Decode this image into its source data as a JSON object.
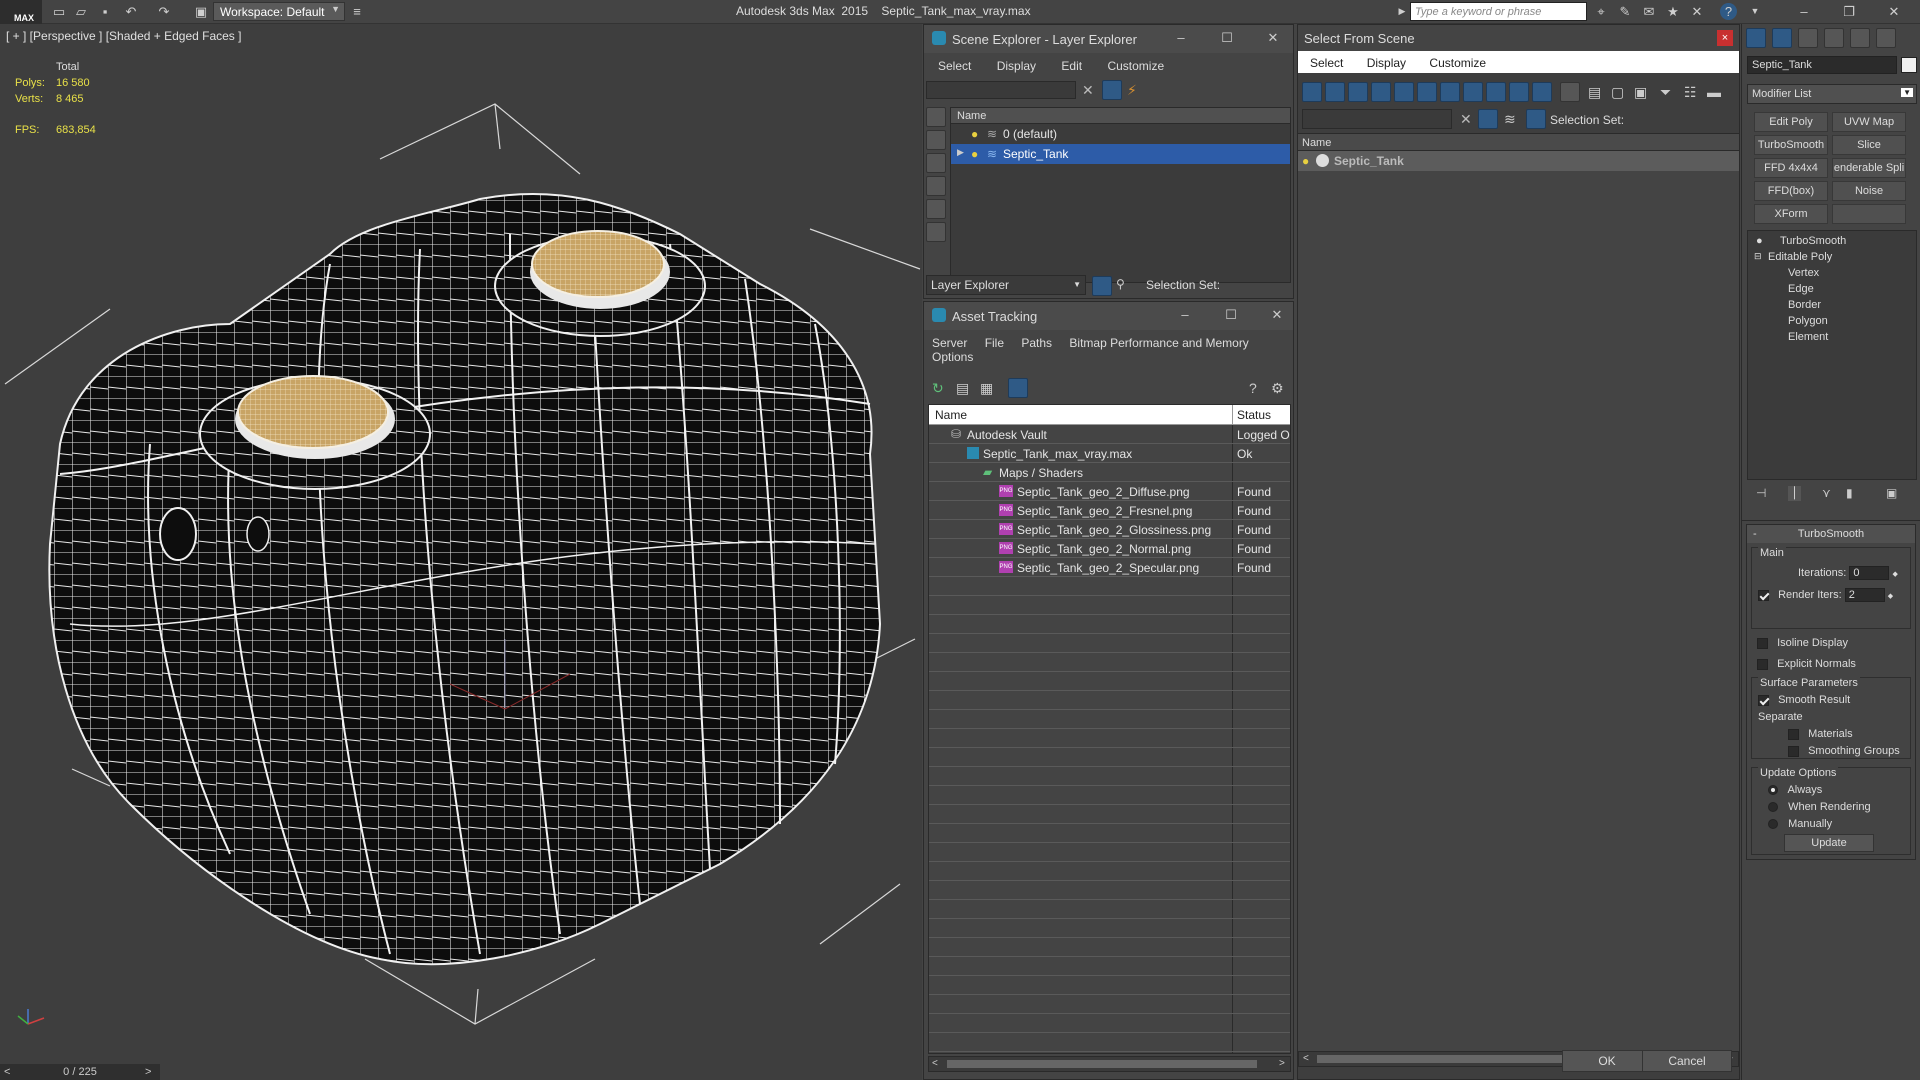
{
  "app": {
    "logo": "MAX",
    "workspace": "Workspace: Default",
    "title": "Autodesk 3ds Max  2015    Septic_Tank_max_vray.max",
    "search_placeholder": "Type a keyword or phrase"
  },
  "viewport": {
    "label": "[ + ] [Perspective ] [Shaded + Edged Faces ]",
    "stats": {
      "total_label": "Total",
      "polys_label": "Polys:",
      "polys": "16 580",
      "verts_label": "Verts:",
      "verts": "8 465",
      "fps_label": "FPS:",
      "fps": "683,854"
    },
    "timeline": "0 / 225"
  },
  "scene_explorer": {
    "title": "Scene Explorer - Layer Explorer",
    "menu": [
      "Select",
      "Display",
      "Edit",
      "Customize"
    ],
    "column": "Name",
    "rows": [
      "0 (default)",
      "Septic_Tank"
    ],
    "footer_label": "Layer Explorer",
    "selection_set": "Selection Set:"
  },
  "asset_tracking": {
    "title": "Asset Tracking",
    "menu": [
      "Server",
      "File",
      "Paths",
      "Bitmap Performance and Memory"
    ],
    "menu2": "Options",
    "col_name": "Name",
    "col_status": "Status",
    "rows": [
      {
        "name": "Autodesk Vault",
        "status": "Logged Ou"
      },
      {
        "name": "Septic_Tank_max_vray.max",
        "status": "Ok"
      },
      {
        "name": "Maps / Shaders",
        "status": ""
      },
      {
        "name": "Septic_Tank_geo_2_Diffuse.png",
        "status": "Found"
      },
      {
        "name": "Septic_Tank_geo_2_Fresnel.png",
        "status": "Found"
      },
      {
        "name": "Septic_Tank_geo_2_Glossiness.png",
        "status": "Found"
      },
      {
        "name": "Septic_Tank_geo_2_Normal.png",
        "status": "Found"
      },
      {
        "name": "Septic_Tank_geo_2_Specular.png",
        "status": "Found"
      }
    ],
    "png_badge": "PNG"
  },
  "select_from_scene": {
    "title": "Select From Scene",
    "menu": [
      "Select",
      "Display",
      "Customize"
    ],
    "selection_set": "Selection Set:",
    "column": "Name",
    "row": "Septic_Tank",
    "ok": "OK",
    "cancel": "Cancel"
  },
  "command_panel": {
    "object_name": "Septic_Tank",
    "modifier_list": "Modifier List",
    "buttons": [
      "Edit Poly",
      "UVW Map",
      "TurboSmooth",
      "Slice",
      "FFD 4x4x4",
      "enderable Spli",
      "FFD(box)",
      "Noise",
      "XForm",
      ""
    ],
    "stack": {
      "turbosmooth": "TurboSmooth",
      "editable_poly": "Editable Poly",
      "subs": [
        "Vertex",
        "Edge",
        "Border",
        "Polygon",
        "Element"
      ]
    },
    "rollout": {
      "title": "TurboSmooth",
      "main": "Main",
      "iterations_label": "Iterations:",
      "iterations": "0",
      "render_iters_label": "Render Iters:",
      "render_iters": "2",
      "isoline": "Isoline Display",
      "explicit": "Explicit Normals",
      "surface": "Surface Parameters",
      "smooth": "Smooth Result",
      "separate": "Separate",
      "materials": "Materials",
      "smoothing_groups": "Smoothing Groups",
      "update_options": "Update Options",
      "always": "Always",
      "when_rendering": "When Rendering",
      "manually": "Manually",
      "update": "Update"
    }
  },
  "colors": {
    "selection_blue": "#2d5ca8",
    "tank_black": "#0d0d0d",
    "cap_tan": "#c8a465",
    "stat_yellow": "#e8e048"
  }
}
